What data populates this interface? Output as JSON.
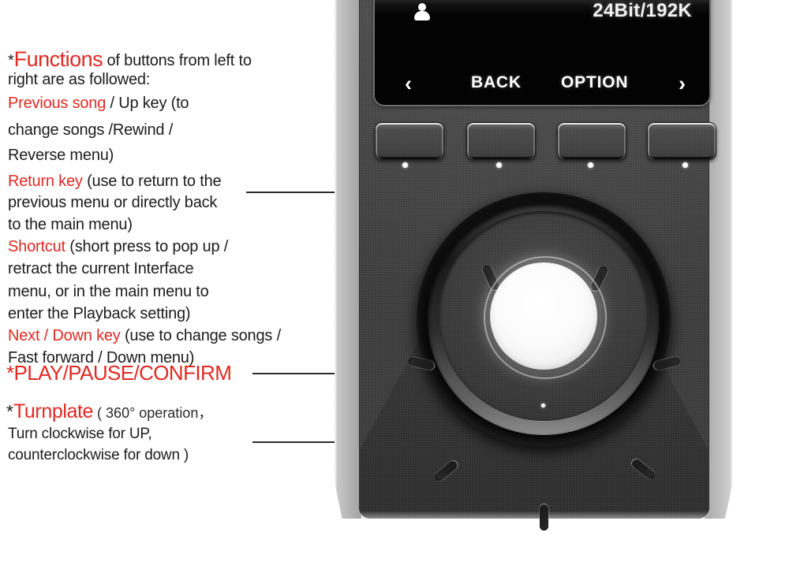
{
  "annotation": {
    "heading": {
      "asterisk": "*",
      "keyword": "Functions",
      "rest_line1": " of buttons from left to",
      "line2": "right are as followed:"
    },
    "items": [
      {
        "label": "Previous song",
        "lines": [
          " / Up key (to",
          "change songs /Rewind /",
          "Reverse menu)"
        ]
      },
      {
        "label": "Return key",
        "lines": [
          " (use to return to the",
          "previous menu or directly back",
          " to the main menu)"
        ]
      },
      {
        "label": "Shortcut",
        "lines": [
          " (short press to pop up /",
          " retract the current Interface",
          "menu, or in the main menu to",
          "enter the Playback setting)"
        ]
      },
      {
        "label": "Next / Down key",
        "lines": [
          " (use to change songs /",
          "Fast forward / Down menu)"
        ]
      }
    ],
    "play_label": "*PLAY/PAUSE/CONFIRM",
    "turnplate": {
      "asterisk": "*",
      "keyword": "Turnplate",
      "line1_rest": " ( 360°  operation，",
      "line2": "Turn  clockwise for UP,",
      "line3": "counterclockwise for down )"
    },
    "accent_color": "#e02a22",
    "text_color": "#1c1c1c"
  },
  "device": {
    "screen": {
      "user_icon": "user-icon",
      "bitrate": "24Bit/192K",
      "nav": {
        "prev_arrow": "‹",
        "back": "BACK",
        "option": "OPTION",
        "next_arrow": "›"
      }
    },
    "buttons": [
      {
        "name": "previous-song-button"
      },
      {
        "name": "return-key-button"
      },
      {
        "name": "shortcut-button"
      },
      {
        "name": "next-down-key-button"
      }
    ],
    "jogwheel": {
      "name": "turnplate",
      "center_button": "play-pause-confirm",
      "slot_count": 7
    }
  }
}
